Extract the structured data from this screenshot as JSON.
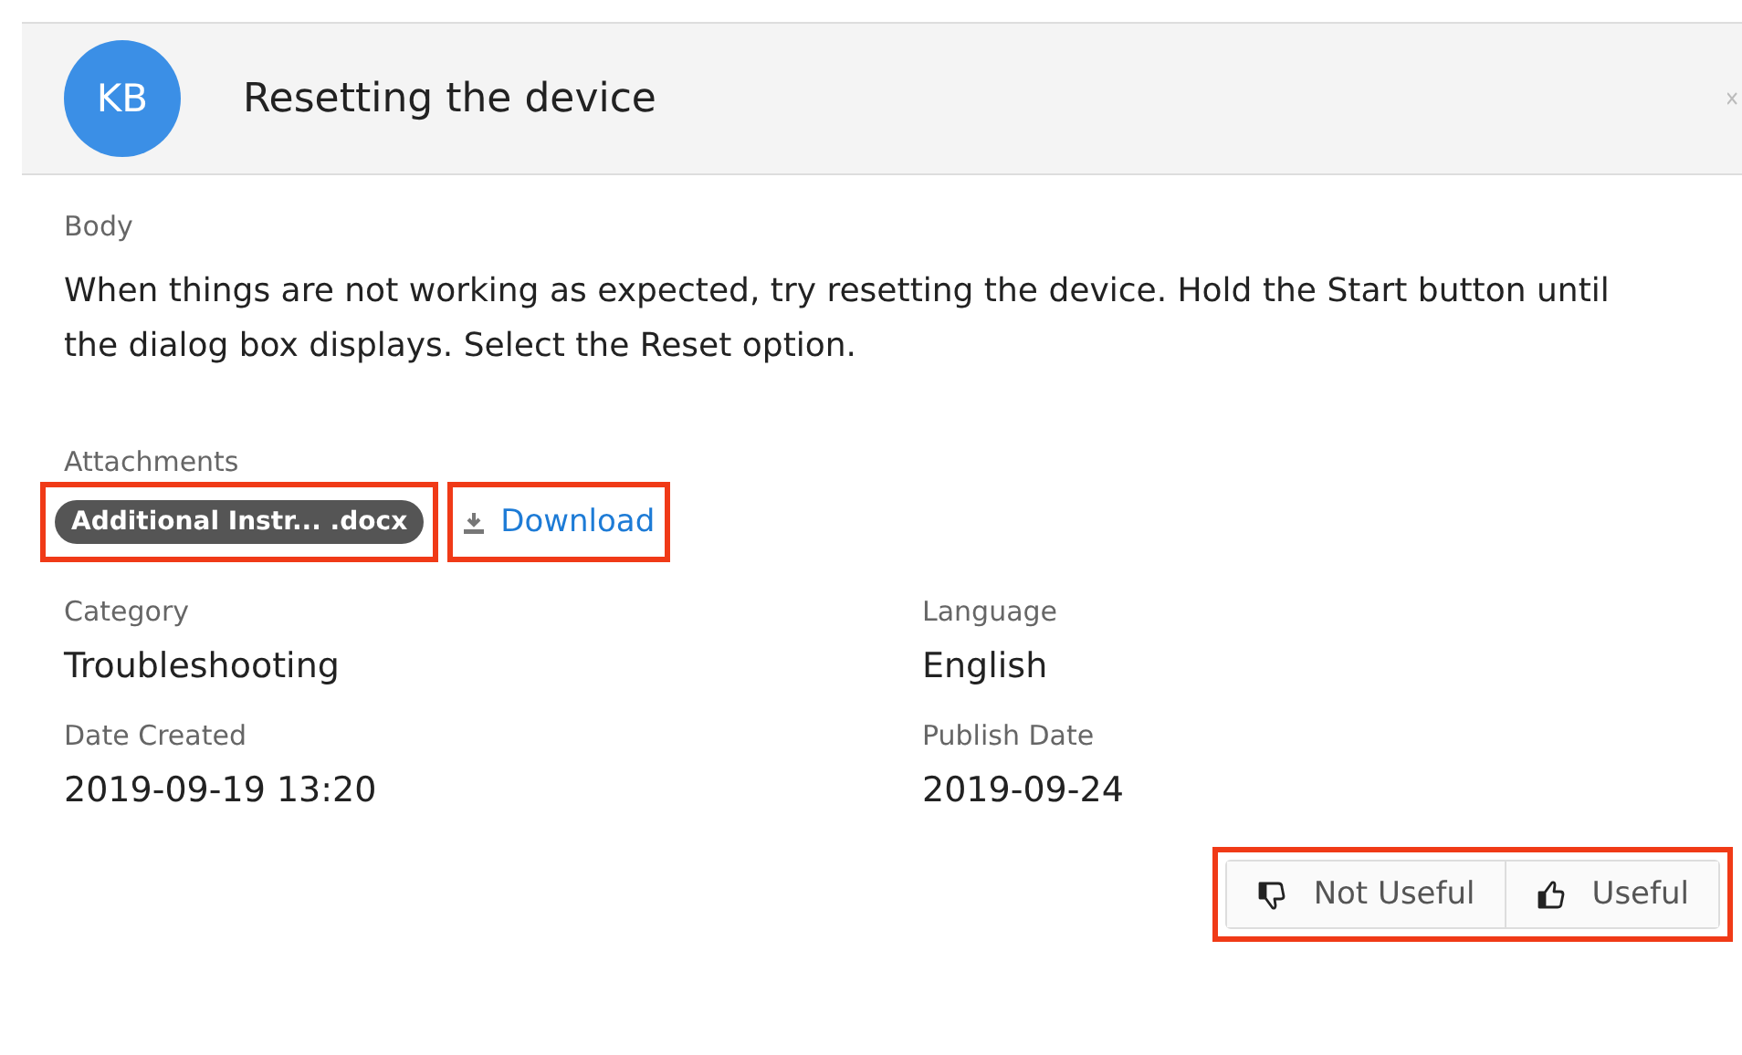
{
  "header": {
    "avatar": "KB",
    "title": "Resetting the device"
  },
  "body": {
    "label": "Body",
    "text": "When things are not working as expected, try resetting the device. Hold the Start button until the dialog box displays. Select the Reset option."
  },
  "attachments": {
    "label": "Attachments",
    "file": {
      "name": "Additional Instr... .docx",
      "highlighted": true
    },
    "download": {
      "label": "Download",
      "highlighted": true
    }
  },
  "fields": [
    {
      "label": "Category",
      "value": "Troubleshooting"
    },
    {
      "label": "Language",
      "value": "English"
    },
    {
      "label": "Date Created",
      "value": "2019-09-19 13:20"
    },
    {
      "label": "Publish Date",
      "value": "2019-09-24"
    }
  ],
  "feedback": {
    "highlighted": true,
    "buttons": [
      {
        "kind": "not_useful",
        "label": "Not Useful"
      },
      {
        "kind": "useful",
        "label": "Useful"
      }
    ]
  }
}
